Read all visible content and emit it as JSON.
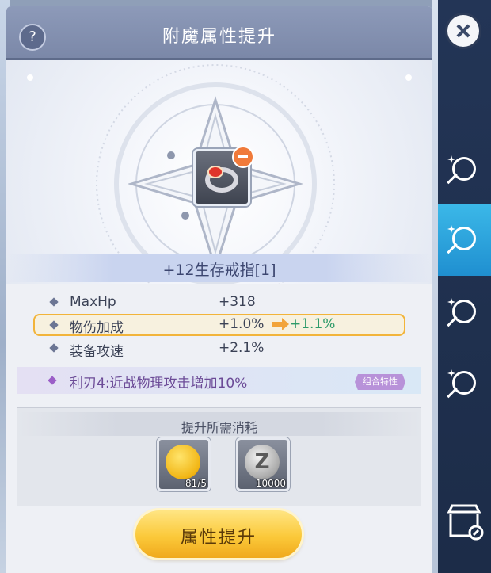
{
  "window": {
    "title": "附魔属性提升",
    "help_label": "?"
  },
  "item": {
    "name": "+12生存戒指[1]",
    "icon": "ring-icon",
    "badge": "minus-icon"
  },
  "attributes": [
    {
      "name": "MaxHp",
      "value": "+318"
    },
    {
      "name": "物伤加成",
      "value": "+1.0%",
      "new_value": "+1.1%",
      "highlighted": true
    },
    {
      "name": "装备攻速",
      "value": "+2.1%"
    }
  ],
  "trait": {
    "text": "利刃4:近战物理攻击增加10%",
    "tag": "组合特性"
  },
  "cost": {
    "title": "提升所需消耗",
    "items": [
      {
        "icon": "gold-medal-icon",
        "qty": "81/5"
      },
      {
        "icon": "zeny-coin-icon",
        "symbol": "Z",
        "qty": "10000"
      }
    ]
  },
  "actions": {
    "upgrade_label": "属性提升"
  },
  "colors": {
    "accent": "#3bb8e8",
    "button": "#fbc93a",
    "highlight": "#f2b43a",
    "increase": "#2f9b6a"
  },
  "sidebar": {
    "tabs": [
      {
        "icon": "enchant-wand-icon",
        "active": false
      },
      {
        "icon": "enchant-upgrade-icon",
        "active": true
      },
      {
        "icon": "enchant-refresh-icon",
        "active": false
      },
      {
        "icon": "enchant-list-icon",
        "active": false
      }
    ],
    "shop_icon": "shop-icon"
  }
}
